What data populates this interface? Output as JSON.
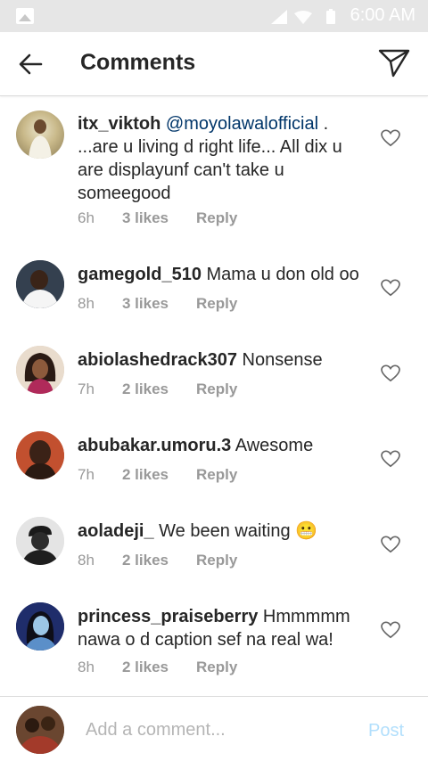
{
  "status_bar": {
    "time": "6:00 AM"
  },
  "header": {
    "title": "Comments"
  },
  "comments": [
    {
      "username": "itx_viktoh",
      "mention": "@moyolawalofficial",
      "text": " . ...are u living d right life... All dix u are displayunf can't take u someegood",
      "time": "6h",
      "likes": "3 likes",
      "reply": "Reply"
    },
    {
      "username": "gamegold_510",
      "text": " Mama u don old oo",
      "time": "8h",
      "likes": "3 likes",
      "reply": "Reply"
    },
    {
      "username": "abiolashedrack307",
      "text": " Nonsense",
      "time": "7h",
      "likes": "2 likes",
      "reply": "Reply"
    },
    {
      "username": "abubakar.umoru.3",
      "text": " Awesome",
      "time": "7h",
      "likes": "2 likes",
      "reply": "Reply"
    },
    {
      "username": "aoladeji_",
      "text": " We been waiting 😬",
      "time": "8h",
      "likes": "2 likes",
      "reply": "Reply"
    },
    {
      "username": "princess_praiseberry",
      "text": " Hmmmmm nawa o d caption sef na real wa!",
      "time": "8h",
      "likes": "2 likes",
      "reply": "Reply"
    }
  ],
  "composer": {
    "placeholder": "Add a comment...",
    "post_label": "Post"
  },
  "colors": {
    "mention": "#003569",
    "post_disabled": "#b2dffc",
    "meta": "#999999"
  }
}
